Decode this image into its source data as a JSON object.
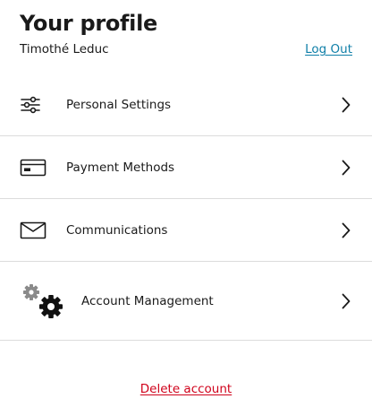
{
  "header": {
    "title": "Your profile",
    "user_name": "Timothé Leduc",
    "logout_label": "Log Out"
  },
  "menu": {
    "items": [
      {
        "label": "Personal Settings",
        "icon": "sliders-icon"
      },
      {
        "label": "Payment Methods",
        "icon": "credit-card-icon"
      },
      {
        "label": "Communications",
        "icon": "envelope-icon"
      },
      {
        "label": "Account Management",
        "icon": "gears-icon"
      }
    ]
  },
  "footer": {
    "delete_label": "Delete account"
  },
  "colors": {
    "link": "#0f7fa8",
    "danger": "#d0021b",
    "divider": "#dcdcdc",
    "text": "#1a1a1a"
  }
}
